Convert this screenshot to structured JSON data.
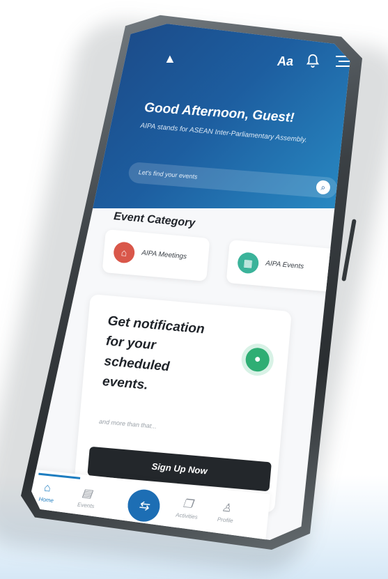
{
  "header": {
    "greeting": "Good Afternoon, Guest!",
    "subtitle": "AIPA stands for ASEAN Inter-Parliamentary Assembly.",
    "search_placeholder": "Let's find your events",
    "font_size_label": "Aa"
  },
  "category": {
    "title": "Event Category",
    "items": [
      {
        "label": "AIPA Meetings",
        "icon": "meeting-icon",
        "color": "#d9574a"
      },
      {
        "label": "AIPA Events",
        "icon": "events-icon",
        "color": "#3bb39a"
      }
    ]
  },
  "notification_card": {
    "title": "Get notification for your scheduled events.",
    "subtitle": "and more than that...",
    "button_label": "Sign Up Now"
  },
  "nav": {
    "items": [
      {
        "label": "Home",
        "icon": "home-icon"
      },
      {
        "label": "Events",
        "icon": "calendar-icon"
      },
      {
        "label": "",
        "icon": "scan-icon"
      },
      {
        "label": "Activities",
        "icon": "activities-icon"
      },
      {
        "label": "Profile",
        "icon": "profile-icon"
      }
    ],
    "active": "Home"
  },
  "colors": {
    "header_start": "#1a3f7a",
    "header_end": "#2a8fc7",
    "accent": "#1d6eb4",
    "button_dark": "#23272b"
  }
}
